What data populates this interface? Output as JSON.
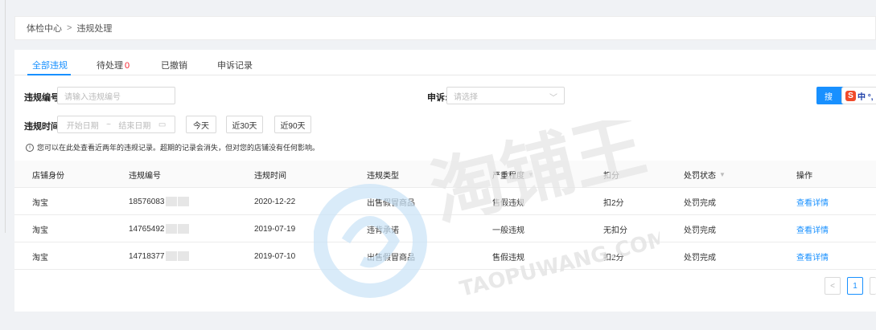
{
  "breadcrumb": {
    "root": "体检中心",
    "separator": ">",
    "current": "违规处理"
  },
  "tabs": [
    {
      "label": "全部违规",
      "active": true
    },
    {
      "label": "待处理",
      "count": "0"
    },
    {
      "label": "已撤销"
    },
    {
      "label": "申诉记录"
    }
  ],
  "filters": {
    "violation_no_label": "违规编号:",
    "violation_no_placeholder": "请输入违规编号",
    "appeal_label": "申诉:",
    "appeal_placeholder": "请选择",
    "time_label": "违规时间:",
    "start_date_placeholder": "开始日期",
    "range_sep": "~",
    "end_date_placeholder": "结束日期",
    "quick_today": "今天",
    "quick_30": "近30天",
    "quick_90": "近90天",
    "search_label": "搜"
  },
  "ime": {
    "logo": "S",
    "text": "中 °,"
  },
  "notice": "您可以在此处查看近两年的违规记录。超期的记录会消失，但对您的店铺没有任何影响。",
  "table": {
    "headers": [
      "店铺身份",
      "违规编号",
      "违规时间",
      "违规类型",
      "严重程度",
      "扣分",
      "处罚状态",
      "操作"
    ],
    "rows": [
      {
        "shop": "淘宝",
        "id": "18576083",
        "time": "2020-12-22",
        "type": "出售假冒商品",
        "severity": "售假违规",
        "points": "扣2分",
        "status": "处罚完成",
        "action": "查看详情"
      },
      {
        "shop": "淘宝",
        "id": "14765492",
        "time": "2019-07-19",
        "type": "违背承诺",
        "severity": "一般违规",
        "points": "无扣分",
        "status": "处罚完成",
        "action": "查看详情"
      },
      {
        "shop": "淘宝",
        "id": "14718377",
        "time": "2019-07-10",
        "type": "出售假冒商品",
        "severity": "售假违规",
        "points": "扣2分",
        "status": "处罚完成",
        "action": "查看详情"
      }
    ]
  },
  "pagination": {
    "prev": "<",
    "current": "1"
  },
  "watermark": {
    "text_cn": "淘铺王",
    "text_en": "TAOPUWANG.COM"
  }
}
